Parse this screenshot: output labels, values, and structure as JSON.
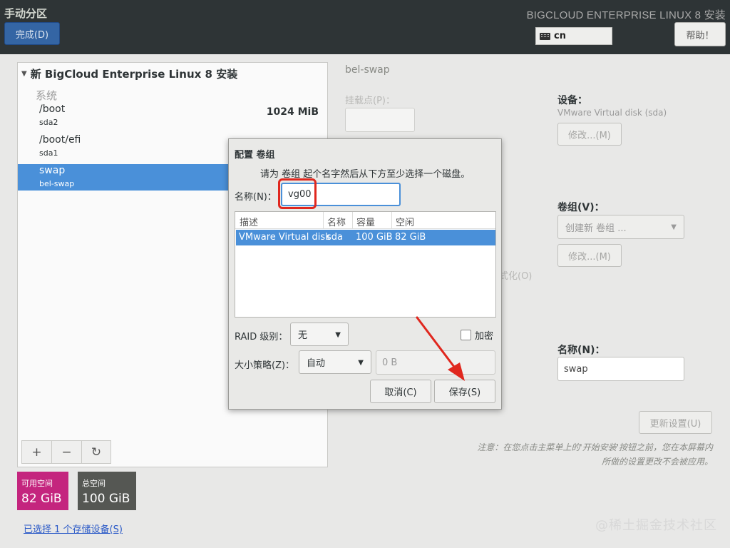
{
  "header": {
    "title": "手动分区",
    "done_label": "完成(D)",
    "product": "BIGCLOUD ENTERPRISE LINUX 8 安装",
    "keyboard_layout": "cn",
    "help_label": "帮助！"
  },
  "left": {
    "tree_title": "新 BigCloud Enterprise Linux 8 安装",
    "group_label": "系统",
    "mounts": [
      {
        "mount": "/boot",
        "device": "sda2",
        "size": "1024 MiB",
        "selected": false
      },
      {
        "mount": "/boot/efi",
        "device": "sda1",
        "size": "",
        "selected": false
      },
      {
        "mount": "swap",
        "device": "bel-swap",
        "size": "",
        "selected": true
      }
    ],
    "toolbar": {
      "add": "+",
      "remove": "−",
      "refresh": "↻"
    },
    "available": {
      "label": "可用空间",
      "value": "82 GiB"
    },
    "total": {
      "label": "总空间",
      "value": "100 GiB"
    },
    "storage_link": "已选择 1 个存储设备(S)"
  },
  "right": {
    "title": "bel-swap",
    "mount_label": "挂载点(P)：",
    "device_label": "设备：",
    "device_desc": "VMware Virtual disk (sda)",
    "modify1_label": "修改...(M)",
    "vg_label": "卷组(V)：",
    "vg_value": "创建新 卷组 ...",
    "modify2_label": "修改...(M)",
    "partial_text": "式化(O)",
    "name_label": "名称(N)：",
    "name_value": "swap",
    "update_label": "更新设置(U)",
    "note": "注意：在您点击主菜单上的'开始安装'按钮之前，您在本屏幕内所做的设置更改不会被应用。",
    "watermark": "@稀土掘金技术社区"
  },
  "dialog": {
    "title": "配置 卷组",
    "description": "请为 卷组 起个名字然后从下方至少选择一个磁盘。",
    "name_label": "名称(N)：",
    "name_value": "vg00",
    "columns": [
      "描述",
      "名称",
      "容量",
      "空闲"
    ],
    "rows": [
      {
        "desc": "VMware Virtual disk",
        "name": "sda",
        "capacity": "100 GiB",
        "free": "82 GiB"
      }
    ],
    "raid_label": "RAID 级别：",
    "raid_value": "无",
    "encrypt_label": "加密",
    "encrypt_checked": false,
    "size_policy_label": "大小策略(Z)：",
    "size_policy_value": "自动",
    "size_value": "0 B",
    "cancel_label": "取消(C)",
    "save_label": "保存(S)"
  },
  "colors": {
    "header_bg": "#2e3436",
    "accent": "#4a90d9",
    "done_button": "#3465a4",
    "available_bg": "#c4257e",
    "total_bg": "#555753",
    "annotation_red": "#e0271e"
  }
}
